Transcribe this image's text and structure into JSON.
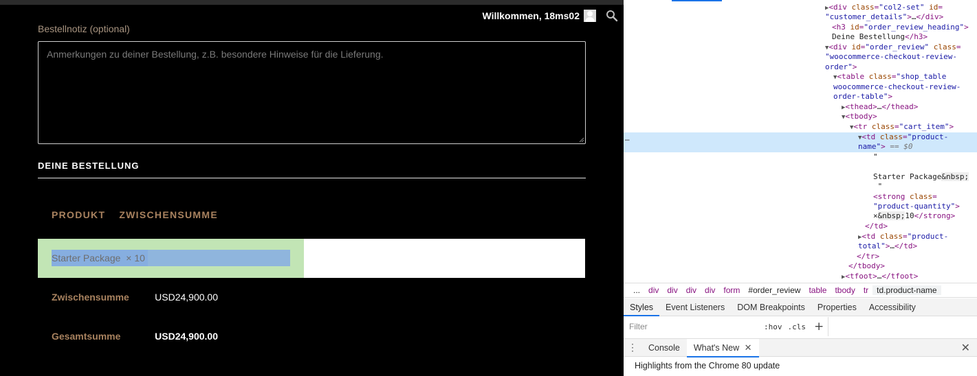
{
  "site": {
    "welcome": "Willkommen, 18ms02",
    "note_label": "Bestellnotiz (optional)",
    "note_placeholder": "Anmerkungen zu deiner Bestellung, z.B. besondere Hinweise für die Lieferung.",
    "order_heading": "DEINE BESTELLUNG",
    "table": {
      "col_product": "PRODUKT",
      "col_subtotal": "ZWISCHENSUMME",
      "item_name": "Starter Package",
      "item_qty": "× 10",
      "subtotal_label": "Zwischensumme",
      "subtotal_value": "USD24,900.00",
      "total_label": "Gesamtsumme",
      "total_value": "USD24,900.00"
    }
  },
  "devtools": {
    "tree": [
      "<div class=\"col2-set\" id=",
      "\"customer_details\">…</div>",
      "<h3 id=\"order_review_heading\">",
      "Deine Bestellung</h3>",
      "<div id=\"order_review\" class=",
      "\"woocommerce-checkout-review-",
      "order\">",
      "<table class=\"shop_table",
      "woocommerce-checkout-review-",
      "order-table\">",
      "<thead>…</thead>",
      "<tbody>",
      "<tr class=\"cart_item\">",
      "<td class=\"product-",
      "name\"> == $0",
      "\"",
      "Starter Package&nbsp;",
      " \"",
      "<strong class=",
      "\"product-quantity\">",
      "×&nbsp;10</strong>",
      "</td>",
      "<td class=\"product-",
      "total\">…</td>",
      "</tr>",
      "</tbody>",
      "<tfoot>…</tfoot>"
    ],
    "breadcrumbs": [
      "...",
      "div",
      "div",
      "div",
      "div",
      "form",
      "#order_review",
      "table",
      "tbody",
      "tr",
      "td.product-name"
    ],
    "panel_tabs": [
      "Styles",
      "Event Listeners",
      "DOM Breakpoints",
      "Properties",
      "Accessibility"
    ],
    "filter_placeholder": "Filter",
    "hov": ":hov",
    "cls": ".cls",
    "plus": "+",
    "drawer_tabs": [
      "Console",
      "What's New"
    ],
    "drawer_content": "Highlights from the Chrome 80 update",
    "selected_dots": "…",
    "colors": {
      "accent": "#a8825f",
      "selection": "#cfe8fc",
      "tab_active": "#1a73e8"
    }
  }
}
